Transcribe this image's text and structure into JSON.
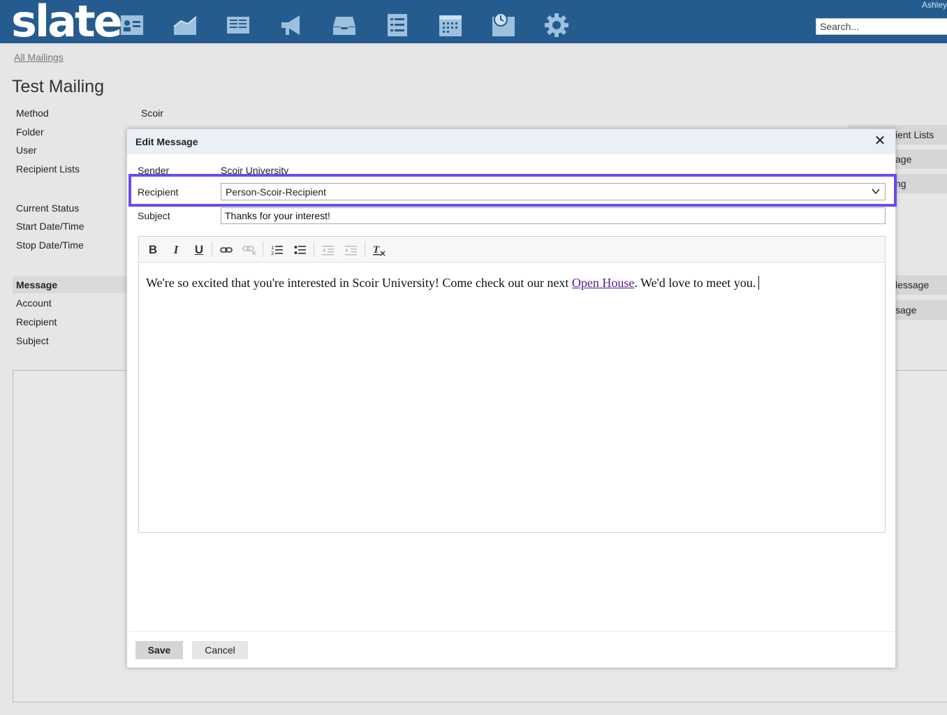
{
  "header": {
    "logo": "slate",
    "user": "Ashley",
    "search_placeholder": "Search...",
    "nav_icons": [
      "contacts-icon",
      "chart-icon",
      "reader-icon",
      "megaphone-icon",
      "inbox-icon",
      "list-icon",
      "calendar-icon",
      "clock-icon",
      "gear-icon"
    ]
  },
  "page": {
    "breadcrumb": "All Mailings",
    "title": "Test Mailing",
    "fields": [
      {
        "label": "Method",
        "value": "Scoir"
      },
      {
        "label": "Folder",
        "value": ""
      },
      {
        "label": "User",
        "value": ""
      },
      {
        "label": "Recipient Lists",
        "value": ""
      },
      {
        "label": "Current Status",
        "value": ""
      },
      {
        "label": "Start Date/Time",
        "value": ""
      },
      {
        "label": "Stop Date/Time",
        "value": ""
      }
    ],
    "message_section": {
      "header": "Message",
      "items": [
        "Account",
        "Recipient",
        "Subject"
      ]
    },
    "right_buttons": [
      "ient Lists",
      "age",
      "ng",
      "lessage",
      "sage"
    ]
  },
  "modal": {
    "title": "Edit Message",
    "sender_label": "Sender",
    "sender_value": "Scoir University",
    "recipient_label": "Recipient",
    "recipient_value": "Person-Scoir-Recipient",
    "subject_label": "Subject",
    "subject_value": "Thanks for your interest!",
    "highlight_color": "#6b4bf0",
    "toolbar": [
      "bold-icon",
      "italic-icon",
      "underline-icon",
      "link-icon",
      "unlink-icon",
      "numbered-list-icon",
      "bulleted-list-icon",
      "outdent-icon",
      "indent-icon",
      "remove-format-icon"
    ],
    "body_text_before": "We're so excited that you're interested in Scoir University! Come check out our next ",
    "body_link": "Open House",
    "body_text_after": ". We'd love to meet you.",
    "save_label": "Save",
    "cancel_label": "Cancel"
  }
}
